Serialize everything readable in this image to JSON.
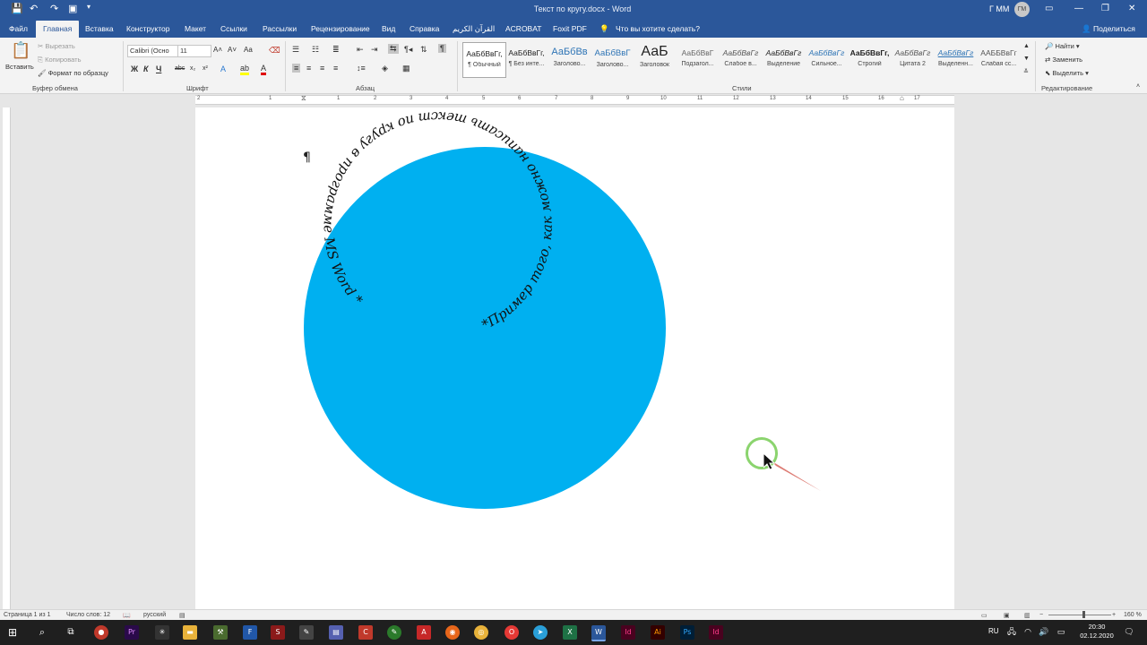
{
  "title_bar": {
    "doc_title": "Текст по кругу.docx  -  Word",
    "user_name": "Г ММ",
    "user_initials": "ГМ"
  },
  "tabs": [
    "Файл",
    "Главная",
    "Вставка",
    "Конструктор",
    "Макет",
    "Ссылки",
    "Рассылки",
    "Рецензирование",
    "Вид",
    "Справка",
    "القرآن الكريم",
    "ACROBAT",
    "Foxit PDF"
  ],
  "tell_me": "Что вы хотите сделать?",
  "share": "Поделиться",
  "clipboard": {
    "paste": "Вставить",
    "cut": "Вырезать",
    "copy": "Копировать",
    "format_painter": "Формат по образцу",
    "label": "Буфер обмена"
  },
  "font": {
    "name": "Calibri (Осно",
    "size": "11",
    "bold": "Ж",
    "italic": "К",
    "underline": "Ч",
    "label": "Шрифт"
  },
  "paragraph": {
    "label": "Абзац"
  },
  "styles": {
    "label": "Стили",
    "items": [
      {
        "preview": "АаБбВвГг,",
        "name": "¶ Обычный"
      },
      {
        "preview": "АаБбВвГг,",
        "name": "¶ Без инте..."
      },
      {
        "preview": "АаБбВв",
        "name": "Заголово..."
      },
      {
        "preview": "АаБбВвГ",
        "name": "Заголово..."
      },
      {
        "preview": "АаБ",
        "name": "Заголовок"
      },
      {
        "preview": "АаБбВвГ",
        "name": "Подзагол..."
      },
      {
        "preview": "АаБбВвГг",
        "name": "Слабое в..."
      },
      {
        "preview": "АаБбВвГг",
        "name": "Выделение"
      },
      {
        "preview": "АаБбВвГг",
        "name": "Сильное..."
      },
      {
        "preview": "АаБбВвГг,",
        "name": "Строгий"
      },
      {
        "preview": "АаБбВвГг",
        "name": "Цитата 2"
      },
      {
        "preview": "АаБбВвГг",
        "name": "Выделенн..."
      },
      {
        "preview": "ААББВвГг",
        "name": "Слабая сс..."
      }
    ]
  },
  "editing": {
    "find": "Найти",
    "replace": "Заменить",
    "select": "Выделить",
    "label": "Редактирование"
  },
  "ruler_numbers": [
    "2",
    "1",
    "1",
    "2",
    "3",
    "4",
    "5",
    "6",
    "7",
    "8",
    "9",
    "10",
    "11",
    "12",
    "13",
    "14",
    "15",
    "16",
    "17"
  ],
  "document": {
    "pilcrow": "¶",
    "circle_color": "#00b0f0",
    "circle_text": "*Пример того, как можно написать текст по кругу в программе MS Word *"
  },
  "status": {
    "page": "Страница 1 из 1",
    "words": "Число слов: 12",
    "language": "русский",
    "zoom": "160 %"
  },
  "taskbar": {
    "lang": "RU",
    "time": "20:30",
    "date": "02.12.2020"
  },
  "colors": {
    "accent": "#2b579a",
    "circle": "#00b0f0"
  }
}
